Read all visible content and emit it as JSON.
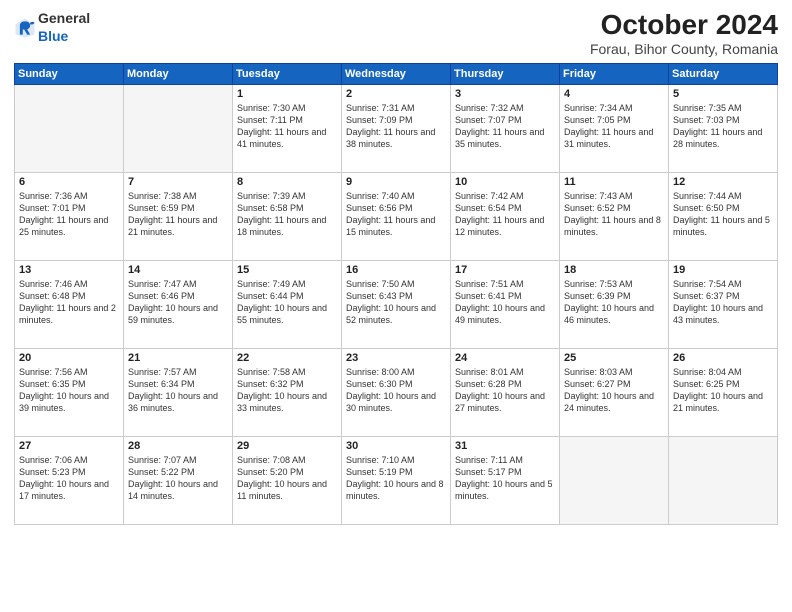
{
  "header": {
    "logo_general": "General",
    "logo_blue": "Blue",
    "month": "October 2024",
    "location": "Forau, Bihor County, Romania"
  },
  "days_of_week": [
    "Sunday",
    "Monday",
    "Tuesday",
    "Wednesday",
    "Thursday",
    "Friday",
    "Saturday"
  ],
  "weeks": [
    [
      {
        "day": "",
        "info": ""
      },
      {
        "day": "",
        "info": ""
      },
      {
        "day": "1",
        "info": "Sunrise: 7:30 AM\nSunset: 7:11 PM\nDaylight: 11 hours and 41 minutes."
      },
      {
        "day": "2",
        "info": "Sunrise: 7:31 AM\nSunset: 7:09 PM\nDaylight: 11 hours and 38 minutes."
      },
      {
        "day": "3",
        "info": "Sunrise: 7:32 AM\nSunset: 7:07 PM\nDaylight: 11 hours and 35 minutes."
      },
      {
        "day": "4",
        "info": "Sunrise: 7:34 AM\nSunset: 7:05 PM\nDaylight: 11 hours and 31 minutes."
      },
      {
        "day": "5",
        "info": "Sunrise: 7:35 AM\nSunset: 7:03 PM\nDaylight: 11 hours and 28 minutes."
      }
    ],
    [
      {
        "day": "6",
        "info": "Sunrise: 7:36 AM\nSunset: 7:01 PM\nDaylight: 11 hours and 25 minutes."
      },
      {
        "day": "7",
        "info": "Sunrise: 7:38 AM\nSunset: 6:59 PM\nDaylight: 11 hours and 21 minutes."
      },
      {
        "day": "8",
        "info": "Sunrise: 7:39 AM\nSunset: 6:58 PM\nDaylight: 11 hours and 18 minutes."
      },
      {
        "day": "9",
        "info": "Sunrise: 7:40 AM\nSunset: 6:56 PM\nDaylight: 11 hours and 15 minutes."
      },
      {
        "day": "10",
        "info": "Sunrise: 7:42 AM\nSunset: 6:54 PM\nDaylight: 11 hours and 12 minutes."
      },
      {
        "day": "11",
        "info": "Sunrise: 7:43 AM\nSunset: 6:52 PM\nDaylight: 11 hours and 8 minutes."
      },
      {
        "day": "12",
        "info": "Sunrise: 7:44 AM\nSunset: 6:50 PM\nDaylight: 11 hours and 5 minutes."
      }
    ],
    [
      {
        "day": "13",
        "info": "Sunrise: 7:46 AM\nSunset: 6:48 PM\nDaylight: 11 hours and 2 minutes."
      },
      {
        "day": "14",
        "info": "Sunrise: 7:47 AM\nSunset: 6:46 PM\nDaylight: 10 hours and 59 minutes."
      },
      {
        "day": "15",
        "info": "Sunrise: 7:49 AM\nSunset: 6:44 PM\nDaylight: 10 hours and 55 minutes."
      },
      {
        "day": "16",
        "info": "Sunrise: 7:50 AM\nSunset: 6:43 PM\nDaylight: 10 hours and 52 minutes."
      },
      {
        "day": "17",
        "info": "Sunrise: 7:51 AM\nSunset: 6:41 PM\nDaylight: 10 hours and 49 minutes."
      },
      {
        "day": "18",
        "info": "Sunrise: 7:53 AM\nSunset: 6:39 PM\nDaylight: 10 hours and 46 minutes."
      },
      {
        "day": "19",
        "info": "Sunrise: 7:54 AM\nSunset: 6:37 PM\nDaylight: 10 hours and 43 minutes."
      }
    ],
    [
      {
        "day": "20",
        "info": "Sunrise: 7:56 AM\nSunset: 6:35 PM\nDaylight: 10 hours and 39 minutes."
      },
      {
        "day": "21",
        "info": "Sunrise: 7:57 AM\nSunset: 6:34 PM\nDaylight: 10 hours and 36 minutes."
      },
      {
        "day": "22",
        "info": "Sunrise: 7:58 AM\nSunset: 6:32 PM\nDaylight: 10 hours and 33 minutes."
      },
      {
        "day": "23",
        "info": "Sunrise: 8:00 AM\nSunset: 6:30 PM\nDaylight: 10 hours and 30 minutes."
      },
      {
        "day": "24",
        "info": "Sunrise: 8:01 AM\nSunset: 6:28 PM\nDaylight: 10 hours and 27 minutes."
      },
      {
        "day": "25",
        "info": "Sunrise: 8:03 AM\nSunset: 6:27 PM\nDaylight: 10 hours and 24 minutes."
      },
      {
        "day": "26",
        "info": "Sunrise: 8:04 AM\nSunset: 6:25 PM\nDaylight: 10 hours and 21 minutes."
      }
    ],
    [
      {
        "day": "27",
        "info": "Sunrise: 7:06 AM\nSunset: 5:23 PM\nDaylight: 10 hours and 17 minutes."
      },
      {
        "day": "28",
        "info": "Sunrise: 7:07 AM\nSunset: 5:22 PM\nDaylight: 10 hours and 14 minutes."
      },
      {
        "day": "29",
        "info": "Sunrise: 7:08 AM\nSunset: 5:20 PM\nDaylight: 10 hours and 11 minutes."
      },
      {
        "day": "30",
        "info": "Sunrise: 7:10 AM\nSunset: 5:19 PM\nDaylight: 10 hours and 8 minutes."
      },
      {
        "day": "31",
        "info": "Sunrise: 7:11 AM\nSunset: 5:17 PM\nDaylight: 10 hours and 5 minutes."
      },
      {
        "day": "",
        "info": ""
      },
      {
        "day": "",
        "info": ""
      }
    ]
  ]
}
